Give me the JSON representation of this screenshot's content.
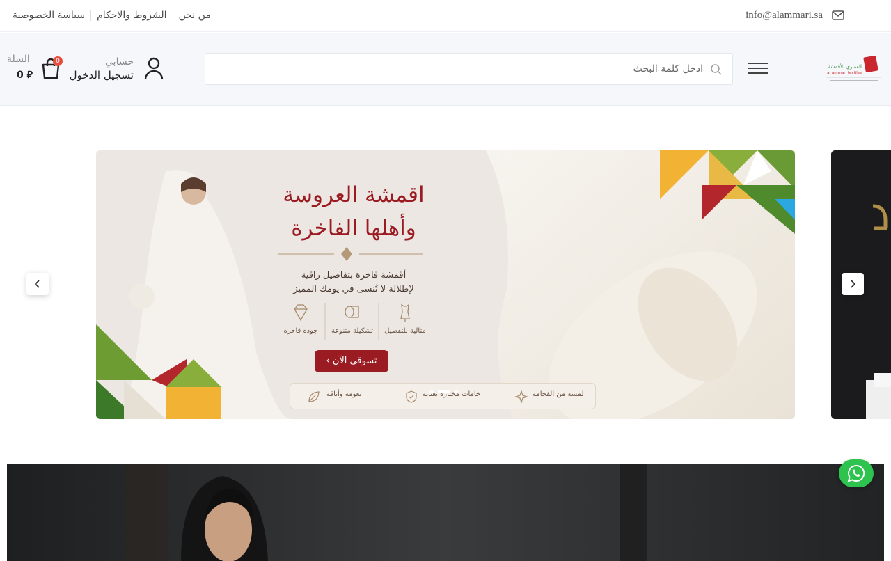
{
  "topbar": {
    "links": [
      {
        "label": "سياسة الخصوصية"
      },
      {
        "label": "الشروط والاحكام"
      },
      {
        "label": "من نحن"
      }
    ],
    "email": "info@alammari.sa"
  },
  "header": {
    "cart": {
      "label": "السلة",
      "total": "0 ⃁",
      "badge": "0"
    },
    "account": {
      "label": "حسابي",
      "login": "تسجيل الدخول"
    },
    "search": {
      "placeholder": "ادخل كلمة البحث",
      "value": ""
    },
    "logo": {
      "brand_ar": "العماري للأقمشة",
      "brand_en": "al ammari textiles"
    }
  },
  "slider": {
    "title_line1": "اقمشة العروسة",
    "title_line2": "وأهلها الفاخرة",
    "subtitle_line1": "أقمشة فاخرة بتفاصيل راقية",
    "subtitle_line2": "لإطلالة لا تُنسى في يومك المميز",
    "features": [
      {
        "label": "جودة فاخرة",
        "icon": "diamond-icon"
      },
      {
        "label": "تشكيلة متنوعة",
        "icon": "fabric-roll-icon"
      },
      {
        "label": "مثالية للتفصيل",
        "icon": "dress-form-icon"
      }
    ],
    "cta": "تسوقي الآن ›",
    "strip": [
      {
        "label": "نعومة وأناقة",
        "icon": "leaf-icon"
      },
      {
        "label": "خامات مختارة بعناية",
        "icon": "shield-icon"
      },
      {
        "label": "لمسة من الفخامة",
        "icon": "sparkle-icon"
      }
    ],
    "active_slide": 1,
    "slide_count": 3
  },
  "colors": {
    "accent": "#9b1b22",
    "whatsapp": "#2ec24e",
    "header_bg": "#f5f7fa"
  }
}
